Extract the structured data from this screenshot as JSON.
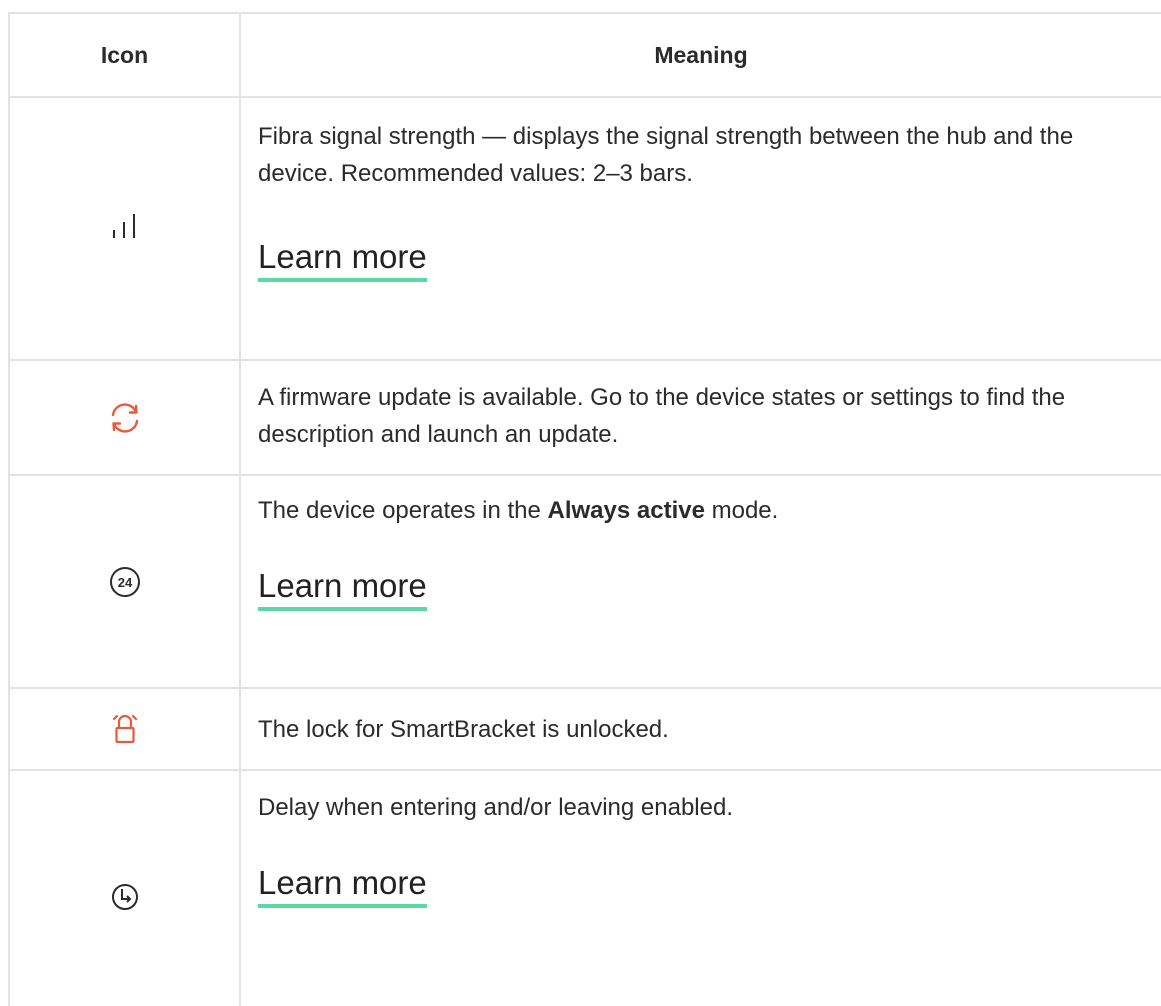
{
  "table": {
    "headers": {
      "icon": "Icon",
      "meaning": "Meaning"
    },
    "rows": [
      {
        "icon": "signal-strength-icon",
        "icon_color": "#2b2b2b",
        "text": "Fibra signal strength — displays the signal strength between the hub and the device. Recommended values: 2–3 bars.",
        "link": "Learn more"
      },
      {
        "icon": "firmware-update-icon",
        "icon_color": "#e8593f",
        "text": "A firmware update is available. Go to the device states or settings to find the description and launch an update."
      },
      {
        "icon": "always-active-24-icon",
        "icon_color": "#2b2b2b",
        "icon_text": "24",
        "text_before": "The device operates in the ",
        "text_bold": "Always active",
        "text_after": " mode.",
        "link": "Learn more"
      },
      {
        "icon": "unlocked-lock-icon",
        "icon_color": "#e8593f",
        "text": "The lock for SmartBracket is unlocked."
      },
      {
        "icon": "delay-clock-icon",
        "icon_color": "#2b2b2b",
        "text": "Delay when entering and/or leaving enabled.",
        "link": "Learn more"
      }
    ]
  },
  "colors": {
    "link_underline": "#5bd9a2",
    "border": "#e3e3e3",
    "accent_red": "#e8593f"
  }
}
